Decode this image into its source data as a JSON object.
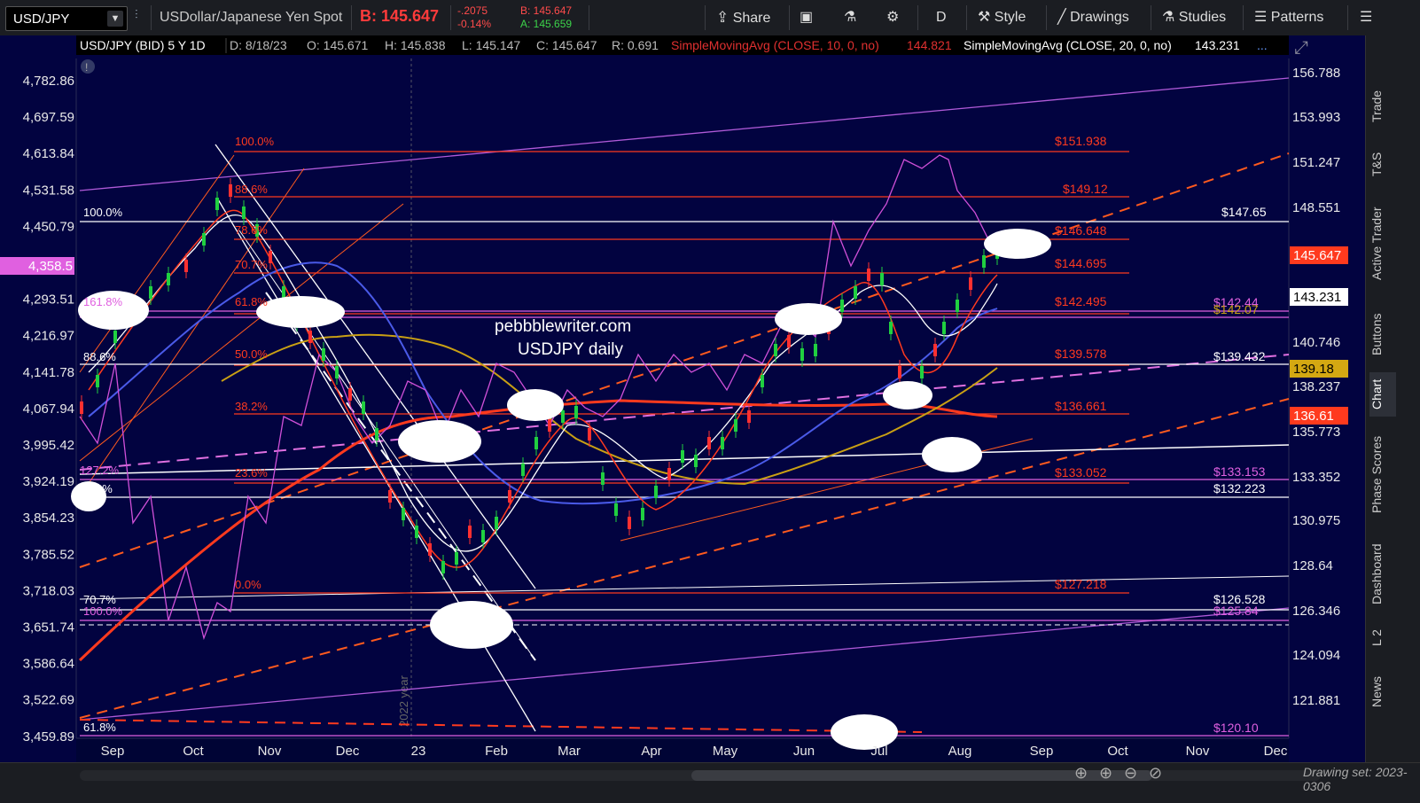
{
  "toolbar": {
    "symbol": "USD/JPY",
    "description": "USDollar/Japanese Yen Spot",
    "bid": "B: 145.647",
    "change": "-.2075",
    "change_pct": "-0.14%",
    "bid_small": "B: 145.647",
    "ask_small": "A: 145.659",
    "share": "Share",
    "period": "D",
    "style": "Style",
    "drawings": "Drawings",
    "studies": "Studies",
    "patterns": "Patterns"
  },
  "header": {
    "title": "USD/JPY (BID) 5 Y 1D",
    "date": "D: 8/18/23",
    "open": "O: 145.671",
    "high": "H: 145.838",
    "low": "L: 145.147",
    "close": "C: 145.647",
    "range": "R: 0.691",
    "sma10": "SimpleMovingAvg (CLOSE, 10, 0, no)",
    "sma10_val": "144.821",
    "sma20": "SimpleMovingAvg (CLOSE, 20, 0, no)",
    "sma20_val": "143.231",
    "more": "..."
  },
  "watermark": {
    "line1": "pebbblewriter.com",
    "line2": "USDJPY daily"
  },
  "year_marker": "2022 year",
  "left_axis": [
    "4,782.86",
    "4,697.59",
    "4,613.84",
    "4,531.58",
    "4,450.79",
    "4,358.5",
    "4,293.51",
    "4,216.97",
    "4,141.78",
    "4,067.94",
    "3,995.42",
    "3,924.19",
    "3,854.23",
    "3,785.52",
    "3,718.03",
    "3,651.74",
    "3,586.64",
    "3,522.69",
    "3,459.89"
  ],
  "right_axis": [
    "156.788",
    "153.993",
    "151.247",
    "148.551",
    "140.746",
    "138.237",
    "135.773",
    "133.352",
    "130.975",
    "128.64",
    "126.346",
    "124.094",
    "121.881"
  ],
  "right_badges": {
    "last": "145.647",
    "sma20": "143.231",
    "gold": "139.18",
    "red": "136.61"
  },
  "x_axis": [
    "Sep",
    "Oct",
    "Nov",
    "Dec",
    "23",
    "Feb",
    "Mar",
    "Apr",
    "May",
    "Jun",
    "Jul",
    "Aug",
    "Sep",
    "Oct",
    "Nov",
    "Dec"
  ],
  "fib_left": {
    "f100": "100.0%",
    "f886": "88.6%",
    "f786": "78.6%",
    "f707": "70.7%",
    "f618": "61.8%",
    "f500": "50.0%",
    "f382": "38.2%",
    "f236": "23.6%",
    "f00": "0.0%"
  },
  "white_fib": {
    "a100": "100.0%",
    "a886": "88.6%",
    "a707": "70.7%",
    "a786": "78.6%",
    "a618": "61.8%"
  },
  "magenta_fib": {
    "m1618": "161.8%",
    "m1272": "127.2%",
    "m100": "100.0%"
  },
  "fib_right": {
    "r1": "$151.938",
    "r2": "$149.12",
    "r3": "$146.648",
    "r4": "$144.695",
    "r5": "$142.495",
    "r6": "$139.578",
    "r7": "$136.661",
    "r8": "$133.052",
    "r9": "$127.218"
  },
  "level_right": {
    "l1": "$147.65",
    "l2": "$142.44",
    "l3": "$142.07",
    "l4": "$139.432",
    "l5": "$133.153",
    "l6": "$132.223",
    "l7": "$126.528",
    "l8": "$125.84",
    "l9": "$120.10"
  },
  "side_tabs": [
    "Trade",
    "T&S",
    "Active Trader",
    "Buttons",
    "Chart",
    "Phase Scores",
    "Dashboard",
    "L 2",
    "News"
  ],
  "drawing_set": "Drawing set: 2023-0306"
}
